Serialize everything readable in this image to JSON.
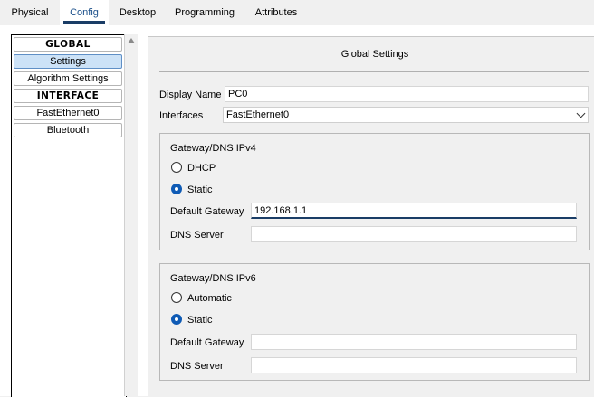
{
  "tabs": [
    {
      "label": "Physical",
      "active": false
    },
    {
      "label": "Config",
      "active": true
    },
    {
      "label": "Desktop",
      "active": false
    },
    {
      "label": "Programming",
      "active": false
    },
    {
      "label": "Attributes",
      "active": false
    }
  ],
  "sidebar": {
    "items": [
      {
        "label": "GLOBAL",
        "kind": "header"
      },
      {
        "label": "Settings",
        "kind": "item",
        "selected": true
      },
      {
        "label": "Algorithm Settings",
        "kind": "item"
      },
      {
        "label": "INTERFACE",
        "kind": "header"
      },
      {
        "label": "FastEthernet0",
        "kind": "item"
      },
      {
        "label": "Bluetooth",
        "kind": "item"
      }
    ]
  },
  "main": {
    "title": "Global Settings",
    "display_name": {
      "label": "Display Name",
      "value": "PC0"
    },
    "interfaces": {
      "label": "Interfaces",
      "value": "FastEthernet0"
    },
    "ipv4": {
      "title": "Gateway/DNS IPv4",
      "option_dhcp": "DHCP",
      "option_static": "Static",
      "selected": "Static",
      "gateway_label": "Default Gateway",
      "gateway_value": "192.168.1.1",
      "dns_label": "DNS Server",
      "dns_value": ""
    },
    "ipv6": {
      "title": "Gateway/DNS IPv6",
      "option_auto": "Automatic",
      "option_static": "Static",
      "selected": "Static",
      "gateway_label": "Default Gateway",
      "gateway_value": "",
      "dns_label": "DNS Server",
      "dns_value": ""
    }
  },
  "colors": {
    "accent": "#1a3d66",
    "selected_bg": "#cce2f7",
    "radio_on": "#0f5bb5"
  }
}
